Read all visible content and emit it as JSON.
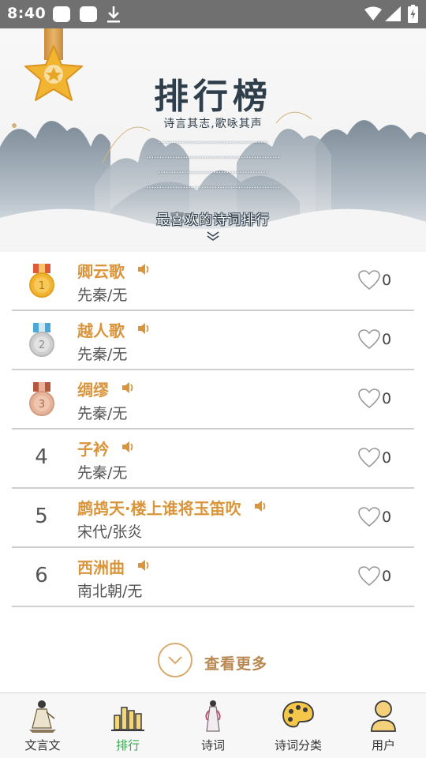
{
  "status_bar": {
    "time": "8:40",
    "icons": [
      "notification-icon",
      "notification-icon",
      "download-icon",
      "wifi-icon",
      "signal-icon",
      "battery-charging-icon"
    ]
  },
  "header": {
    "badge_icon": "gold-star-badge-icon",
    "title": "排行榜",
    "subtitle": "诗言其志,歌咏其声",
    "intro_lines": [
      "……………………………………",
      "……………………………………………",
      "……………………………………",
      "……………………………………………"
    ],
    "favorite_label": "最喜欢的诗词排行",
    "expand_icon": "chevron-down-icon"
  },
  "ranking": {
    "items": [
      {
        "rank": "1",
        "medal": "gold",
        "title": "卿云歌",
        "meta": "先秦/无",
        "likes": "0"
      },
      {
        "rank": "2",
        "medal": "silver",
        "title": "越人歌",
        "meta": "先秦/无",
        "likes": "0"
      },
      {
        "rank": "3",
        "medal": "bronze",
        "title": "绸缪",
        "meta": "先秦/无",
        "likes": "0"
      },
      {
        "rank": "4",
        "medal": "",
        "title": "子衿",
        "meta": "先秦/无",
        "likes": "0"
      },
      {
        "rank": "5",
        "medal": "",
        "title": "鹧鸪天·楼上谁将玉笛吹",
        "meta": "宋代/张炎",
        "likes": "0"
      },
      {
        "rank": "6",
        "medal": "",
        "title": "西洲曲",
        "meta": "南北朝/无",
        "likes": "0"
      }
    ]
  },
  "view_more": {
    "label": "查看更多"
  },
  "bottom_nav": {
    "items": [
      {
        "label": "文言文",
        "icon": "scholar-icon",
        "active": false
      },
      {
        "label": "排行",
        "icon": "bar-chart-icon",
        "active": true
      },
      {
        "label": "诗词",
        "icon": "lady-figure-icon",
        "active": false
      },
      {
        "label": "诗词分类",
        "icon": "palette-icon",
        "active": false
      },
      {
        "label": "用户",
        "icon": "user-icon",
        "active": false
      }
    ]
  },
  "colors": {
    "accent_gold": "#d9953b",
    "title_dark": "#2f3e4b",
    "nav_active": "#2fae4a",
    "status_bar": "#707070"
  }
}
